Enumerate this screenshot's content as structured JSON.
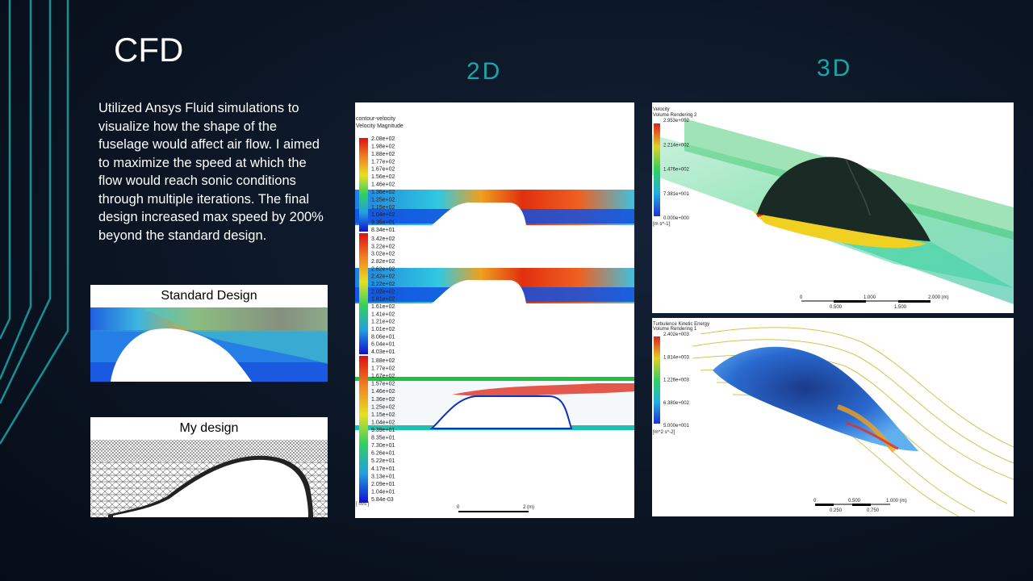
{
  "slide": {
    "title": "CFD",
    "label_2d": "2D",
    "label_3d": "3D",
    "description": "Utilized Ansys Fluid simulations to visualize how the shape of the fuselage would affect air flow. I aimed to maximize the speed at which the flow would reach sonic conditions through multiple iterations. The final design increased max speed by 200% beyond the standard design.",
    "standard_design_label": "Standard Design",
    "my_design_label": "My design"
  },
  "panel_2d": {
    "title1": "contour-velocity",
    "title2": "Velocity Magnitude",
    "legend1": [
      "2.08e+02",
      "1.98e+02",
      "1.88e+02",
      "1.77e+02",
      "1.67e+02",
      "1.56e+02",
      "1.46e+02",
      "1.36e+02",
      "1.25e+02",
      "1.15e+02",
      "1.04e+02",
      "9.35e+01",
      "8.34e+01"
    ],
    "legend2": [
      "3.42e+02",
      "3.22e+02",
      "3.02e+02",
      "2.82e+02",
      "2.62e+02",
      "2.42e+02",
      "2.22e+02",
      "2.02e+02",
      "1.81e+02",
      "1.61e+02",
      "1.41e+02",
      "1.21e+02",
      "1.01e+02",
      "8.06e+01",
      "6.04e+01",
      "4.03e+01"
    ],
    "legend3": [
      "1.88e+02",
      "1.77e+02",
      "1.67e+02",
      "1.57e+02",
      "1.46e+02",
      "1.36e+02",
      "1.25e+02",
      "1.15e+02",
      "1.04e+02",
      "9.39e+01",
      "8.35e+01",
      "7.30e+01",
      "6.26e+01",
      "5.22e+01",
      "4.17e+01",
      "3.13e+01",
      "2.09e+01",
      "1.04e+01",
      "5.84e-03"
    ],
    "unit": "[ m/s ]",
    "scale_start": "0",
    "scale_end": "2 (m)"
  },
  "panel_3d_top": {
    "title1": "Velocity",
    "title2": "Volume Rendering 2",
    "legend": [
      "2.953e+002",
      "2.214e+002",
      "1.476e+002",
      "7.381e+001",
      "0.000e+000"
    ],
    "unit": "[m s^-1]",
    "scale_top": [
      "0",
      "1.000",
      "2.000  (m)"
    ],
    "scale_bottom": [
      "0.500",
      "1.500"
    ]
  },
  "panel_3d_bot": {
    "title1": "Turbulence Kinetic Energy",
    "title2": "Volume Rendering 1",
    "legend": [
      "2.402e+003",
      "1.814e+003",
      "1.226e+003",
      "6.380e+002",
      "5.000e+001"
    ],
    "unit": "[m^2 s^-2]",
    "scale_top": [
      "0",
      "0.500",
      "1.000  (m)"
    ],
    "scale_bottom": [
      "0.250",
      "0.750"
    ]
  }
}
